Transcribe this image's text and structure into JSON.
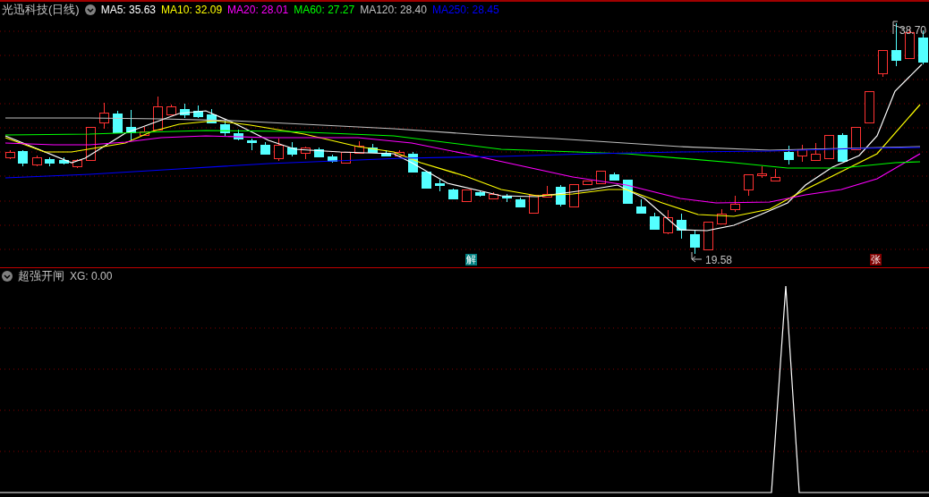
{
  "main_chart": {
    "title": "光迅科技(日线)",
    "indicators": [
      {
        "label": "MA5: 35.63",
        "color": "#ffffff"
      },
      {
        "label": "MA10: 32.09",
        "color": "#ffff00"
      },
      {
        "label": "MA20: 28.01",
        "color": "#ff00ff"
      },
      {
        "label": "MA60: 27.27",
        "color": "#00ff00"
      },
      {
        "label": "MA120: 28.40",
        "color": "#c0c0c0"
      },
      {
        "label": "MA250: 28.45",
        "color": "#0000ff"
      }
    ],
    "high_label": "38.70",
    "low_label": "19.58",
    "markers": [
      {
        "text": "解",
        "color": "#008080"
      },
      {
        "text": "张",
        "color": "#800000"
      }
    ]
  },
  "indicator_panel": {
    "title": "超强开闸",
    "readout": "XG: 0.00"
  }
}
